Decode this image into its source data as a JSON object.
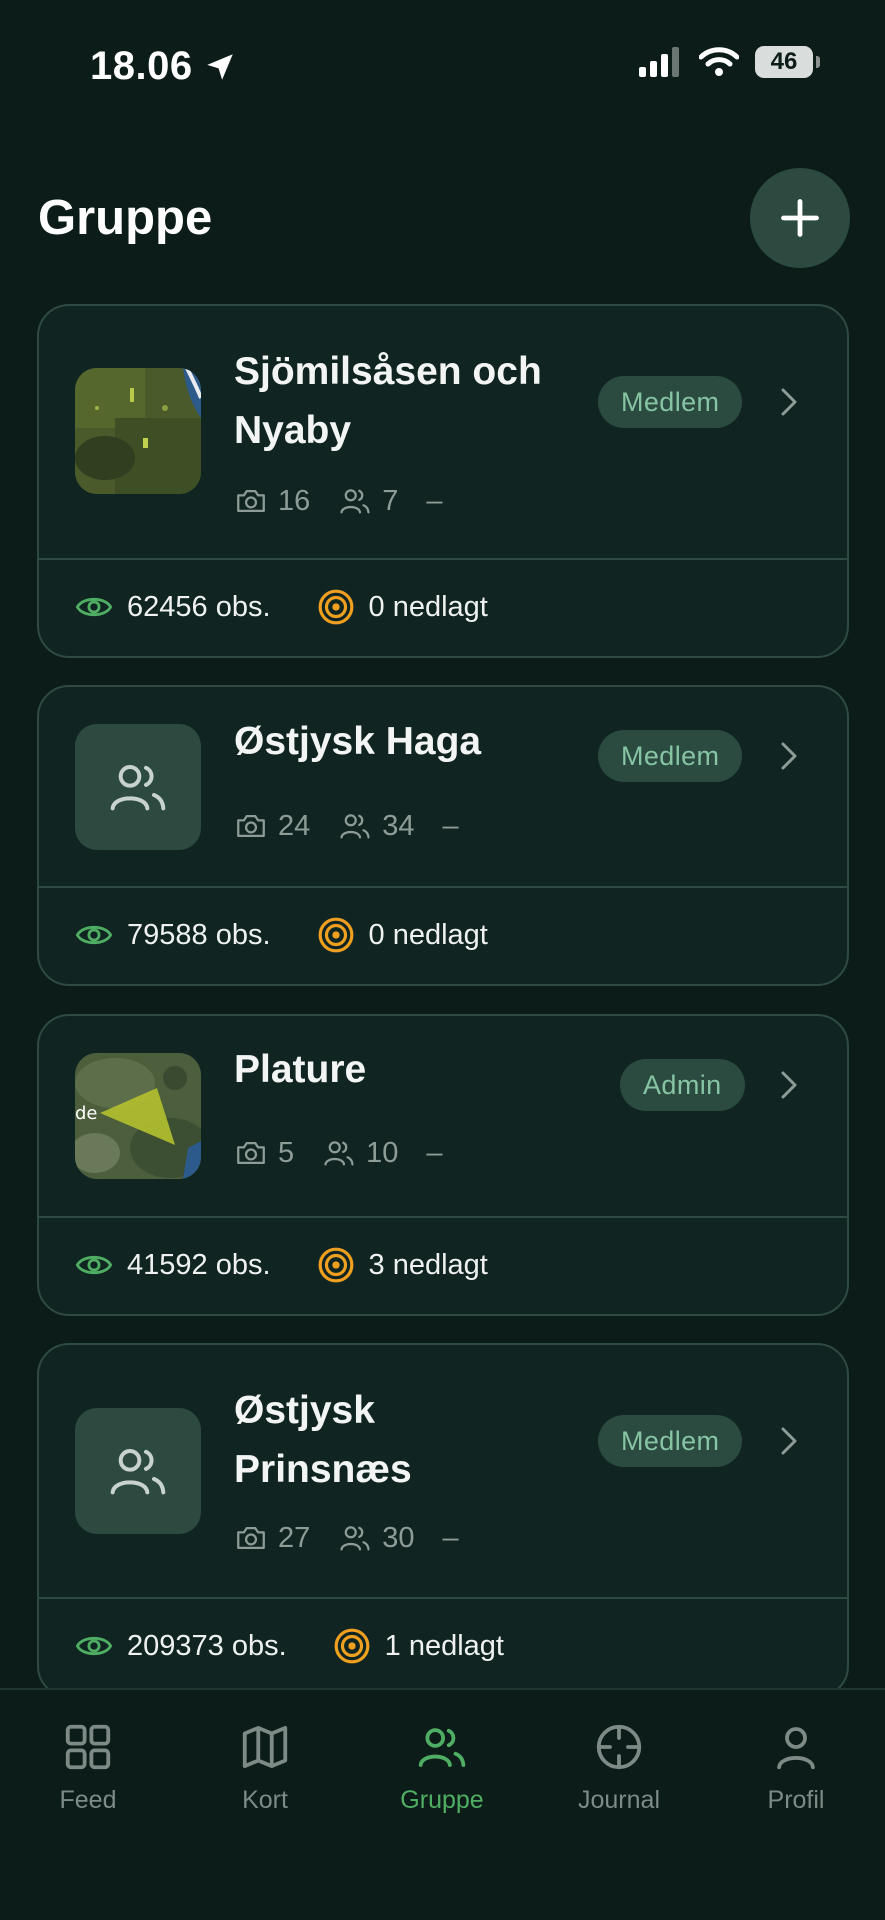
{
  "status_bar": {
    "time": "18.06",
    "battery": "46"
  },
  "header": {
    "title": "Gruppe"
  },
  "groups": [
    {
      "name": "Sjömilsåsen och Nyaby",
      "name_line1": "Sjömilsåsen och",
      "name_line2": "Nyaby",
      "role": "Medlem",
      "photos": "16",
      "members": "7",
      "extra": "–",
      "observations": "62456 obs.",
      "harvested": "0 nedlagt",
      "thumbnail": "satellite-map"
    },
    {
      "name": "Østjysk Haga",
      "role": "Medlem",
      "photos": "24",
      "members": "34",
      "extra": "–",
      "observations": "79588 obs.",
      "harvested": "0 nedlagt",
      "thumbnail": "people-icon"
    },
    {
      "name": "Plature",
      "role": "Admin",
      "photos": "5",
      "members": "10",
      "extra": "–",
      "observations": "41592 obs.",
      "harvested": "3 nedlagt",
      "thumbnail": "satellite-map",
      "thumb_text": "de"
    },
    {
      "name": "Østjysk Prinsnæs",
      "name_line1": "Østjysk",
      "name_line2": "Prinsnæs",
      "role": "Medlem",
      "photos": "27",
      "members": "30",
      "extra": "–",
      "observations": "209373 obs.",
      "harvested": "1 nedlagt",
      "thumbnail": "people-icon"
    }
  ],
  "tabbar": {
    "active": "Gruppe",
    "tabs": [
      {
        "label": "Feed",
        "icon": "grid-icon"
      },
      {
        "label": "Kort",
        "icon": "map-icon"
      },
      {
        "label": "Gruppe",
        "icon": "people-icon"
      },
      {
        "label": "Journal",
        "icon": "crosshair-icon"
      },
      {
        "label": "Profil",
        "icon": "person-icon"
      }
    ]
  },
  "colors": {
    "background": "#0c1c19",
    "card": "#102521",
    "accent": "#4fae63",
    "badge_bg": "#2b4b41",
    "badge_text": "#86c4a3",
    "target": "#f0a020"
  }
}
